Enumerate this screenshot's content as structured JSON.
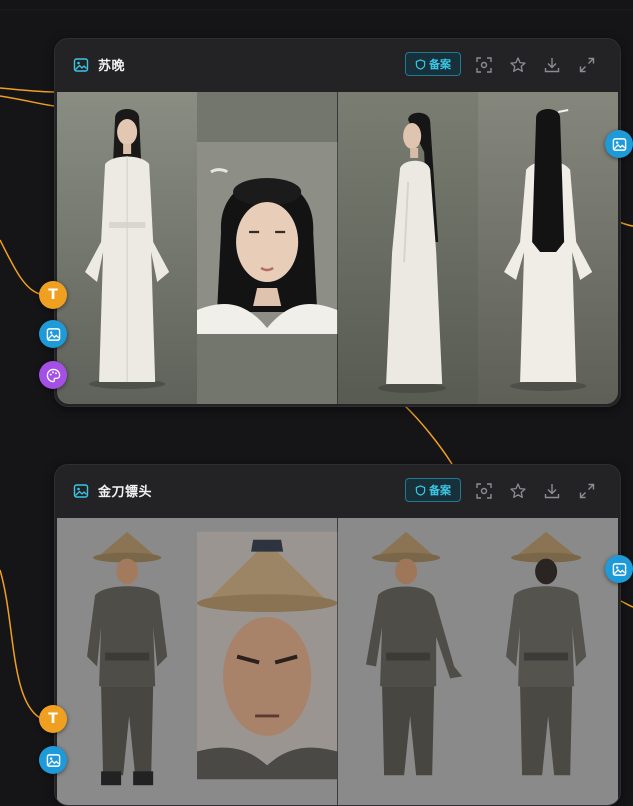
{
  "colors": {
    "background": "#151517",
    "card": "#232326",
    "accent_cyan": "#3cc6e6",
    "connector_orange": "#f0a020",
    "node_text": "#f0a020",
    "node_image": "#1e9ad8",
    "node_palette": "#a450e6"
  },
  "cards": [
    {
      "title": "苏晚",
      "badge_label": "备案",
      "header_icon": "image-icon",
      "tools": [
        "focus-icon",
        "star-icon",
        "download-icon",
        "expand-icon"
      ],
      "views": [
        "front-view",
        "face-closeup",
        "side-view",
        "back-view"
      ]
    },
    {
      "title": "金刀镖头",
      "badge_label": "备案",
      "header_icon": "image-icon",
      "tools": [
        "focus-icon",
        "star-icon",
        "download-icon",
        "expand-icon"
      ],
      "views": [
        "front-view",
        "face-closeup",
        "three-quarter-view",
        "back-view"
      ]
    }
  ],
  "nodes": {
    "text_label": "T"
  }
}
